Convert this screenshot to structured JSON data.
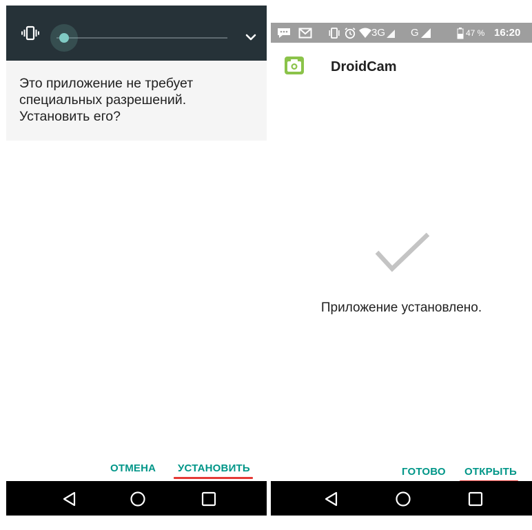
{
  "install_prompt": {
    "prompt_lines": [
      "Это приложение не требует",
      "специальных разрешений.",
      "Установить его?"
    ],
    "cancel_label": "ОТМЕНА",
    "install_label": "УСТАНОВИТЬ",
    "volume_level": 0.05
  },
  "install_done": {
    "status_bar": {
      "network_3g": "3G",
      "network_g": "G",
      "battery_percent": "47 %",
      "time": "16:20"
    },
    "app_name": "DroidCam",
    "message": "Приложение установлено.",
    "done_label": "ГОТОВО",
    "open_label": "ОТКРЫТЬ"
  },
  "colors": {
    "accent": "#009688",
    "highlight_underline": "#e53935",
    "volume_panel": "#263238",
    "status_bar": "#9e9e9e",
    "app_icon": "#8bc34a"
  },
  "icons": [
    "vibrate-icon",
    "chevron-down-icon",
    "message-icon",
    "gmail-icon",
    "alarm-icon",
    "wifi-icon",
    "signal-icon",
    "battery-icon",
    "droidcam-app-icon",
    "check-icon",
    "back-icon",
    "home-icon",
    "recents-icon"
  ]
}
